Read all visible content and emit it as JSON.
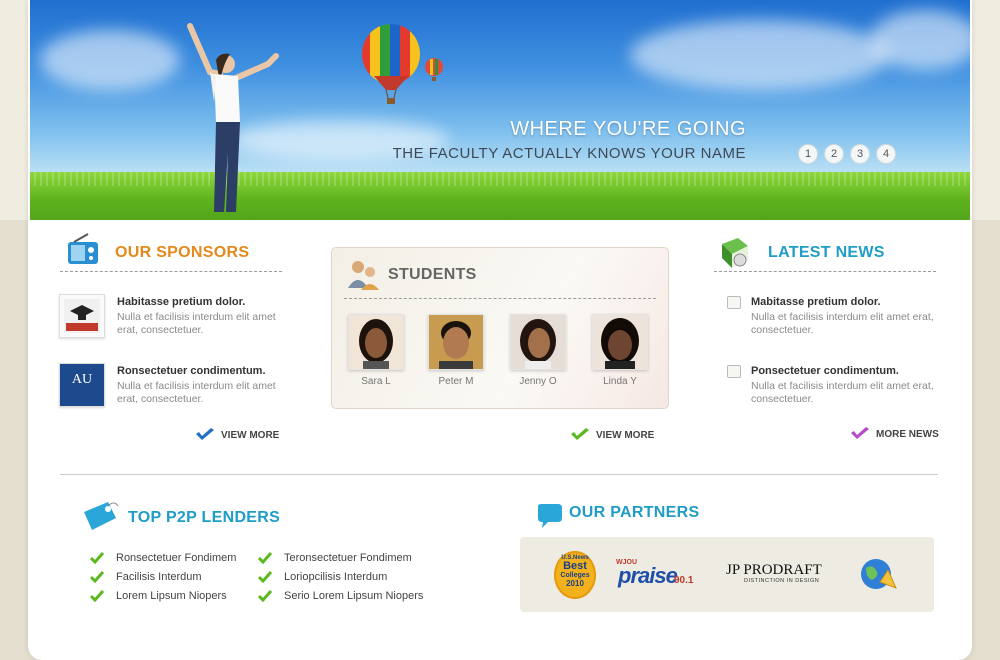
{
  "hero": {
    "title": "WHERE YOU'RE GOING",
    "subtitle": "THE FACULTY ACTUALLY KNOWS YOUR NAME",
    "pager": [
      "1",
      "2",
      "3",
      "4"
    ]
  },
  "sponsors": {
    "title": "OUR SPONSORS",
    "items": [
      {
        "title": "Habitasse pretium dolor.",
        "text": "Nulla et facilisis interdum elit amet erat, consectetuer.",
        "logo_text": ""
      },
      {
        "title": "Ronsectetuer condimentum.",
        "text": "Nulla et facilisis interdum elit amet erat, consectetuer.",
        "logo_text": "AU"
      }
    ],
    "view_more": "VIEW MORE"
  },
  "students": {
    "title": "STUDENTS",
    "people": [
      {
        "name": "Sara L"
      },
      {
        "name": "Peter M"
      },
      {
        "name": "Jenny O"
      },
      {
        "name": "Linda Y"
      }
    ],
    "view_more": "VIEW MORE"
  },
  "news": {
    "title": "LATEST NEWS",
    "items": [
      {
        "title": "Mabitasse pretium dolor.",
        "text": "Nulla et facilisis interdum elit amet erat, consectetuer."
      },
      {
        "title": "Ponsectetuer condimentum.",
        "text": "Nulla et facilisis interdum elit amet erat, consectetuer."
      }
    ],
    "more": "MORE NEWS"
  },
  "lenders": {
    "title": "TOP P2P LENDERS",
    "col1": [
      "Ronsectetuer Fondimem",
      "Facilisis Interdum",
      "Lorem Lipsum Niopers"
    ],
    "col2": [
      "Teronsectetuer Fondimem",
      "Loriopcilisis Interdum",
      "Serio Lorem Lipsum Niopers"
    ]
  },
  "partners": {
    "title": "OUR PARTNERS",
    "logos": {
      "usnews_top": "U.S.News",
      "usnews_main": "Best",
      "usnews_sub": "Colleges",
      "usnews_year": "2010",
      "praise_tag": "WJOU",
      "praise_main": "praise",
      "praise_num": "90.1",
      "jp_main": "JP PRODRAFT",
      "jp_sub": "DISTINCTION IN DESIGN"
    }
  },
  "colors": {
    "accent_orange": "#e48a1c",
    "accent_blue": "#1f9cc7",
    "grass": "#5fb21e",
    "check": "#5cb820"
  }
}
